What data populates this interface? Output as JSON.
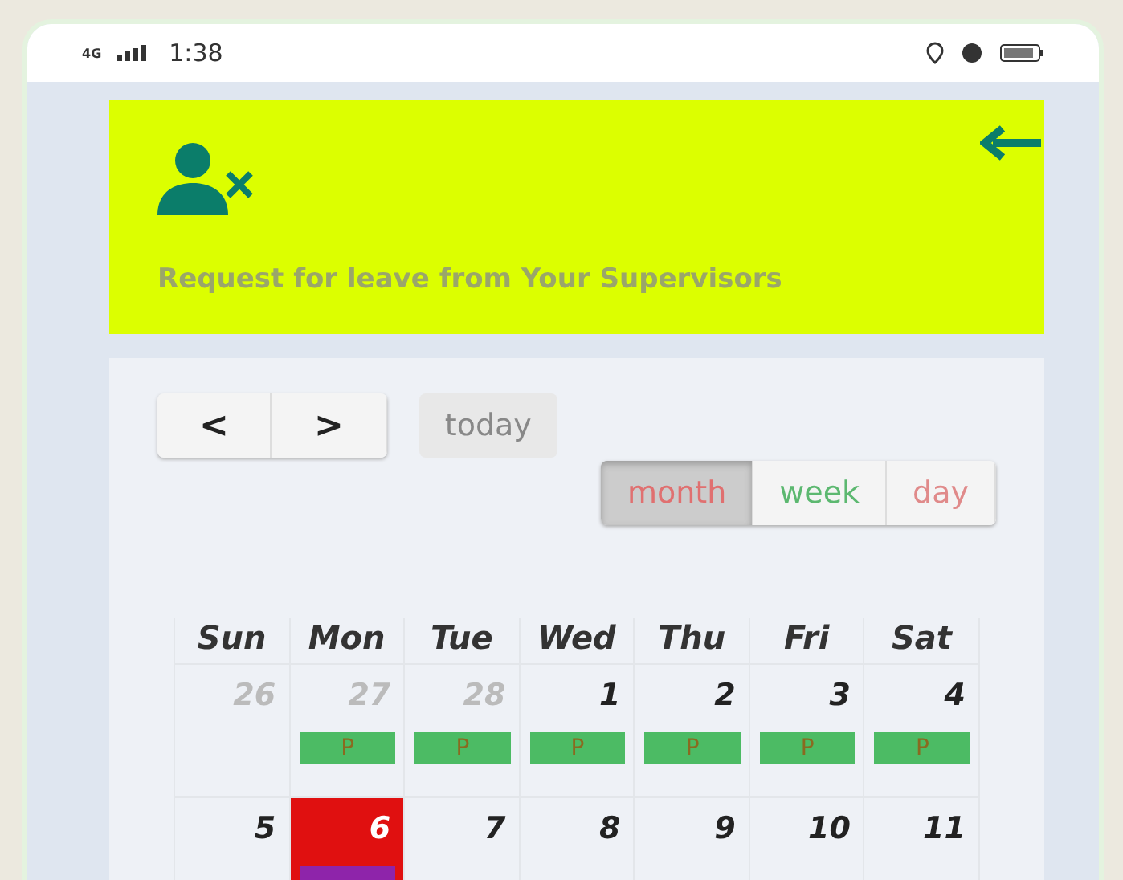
{
  "status_bar": {
    "network": "4G",
    "time": "1:38"
  },
  "header": {
    "title": "Request for leave from Your Supervisors"
  },
  "toolbar": {
    "nav": [
      "<",
      ">"
    ],
    "today": {
      "label": "today",
      "disabled": true
    },
    "views": [
      {
        "label": "month",
        "selected": true,
        "color": "#e07070"
      },
      {
        "label": "week",
        "selected": false,
        "color": "#5cb870"
      },
      {
        "label": "day",
        "selected": false,
        "color": "#e08a8a"
      }
    ]
  },
  "calendar": {
    "weekdays": [
      "Sun",
      "Mon",
      "Tue",
      "Wed",
      "Thu",
      "Fri",
      "Sat"
    ],
    "weeks": [
      [
        {
          "day": "26",
          "other_month": true,
          "today": false
        },
        {
          "day": "27",
          "other_month": true,
          "today": false,
          "events": [
            {
              "title": "P",
              "color": "#4cbb64"
            }
          ]
        },
        {
          "day": "28",
          "other_month": true,
          "today": false,
          "events": [
            {
              "title": "P",
              "color": "#4cbb64"
            }
          ]
        },
        {
          "day": "1",
          "other_month": false,
          "today": false,
          "events": [
            {
              "title": "P",
              "color": "#4cbb64"
            }
          ]
        },
        {
          "day": "2",
          "other_month": false,
          "today": false,
          "events": [
            {
              "title": "P",
              "color": "#4cbb64"
            }
          ]
        },
        {
          "day": "3",
          "other_month": false,
          "today": false,
          "events": [
            {
              "title": "P",
              "color": "#4cbb64"
            }
          ]
        },
        {
          "day": "4",
          "other_month": false,
          "today": false,
          "events": [
            {
              "title": "P",
              "color": "#4cbb64"
            }
          ]
        }
      ],
      [
        {
          "day": "5",
          "other_month": false,
          "today": false
        },
        {
          "day": "6",
          "other_month": false,
          "today": true,
          "events": [
            {
              "color": "#8e24aa"
            }
          ]
        },
        {
          "day": "7",
          "other_month": false,
          "today": false
        },
        {
          "day": "8",
          "other_month": false,
          "today": false
        },
        {
          "day": "9",
          "other_month": false,
          "today": false
        },
        {
          "day": "10",
          "other_month": false,
          "today": false
        },
        {
          "day": "11",
          "other_month": false,
          "today": false
        }
      ]
    ]
  }
}
